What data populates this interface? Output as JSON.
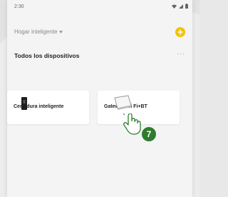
{
  "status_bar": {
    "time": "2:30",
    "icons": [
      "wifi-icon",
      "signal-icon",
      "battery-icon"
    ]
  },
  "header": {
    "home_name": "Hogar inteligente",
    "add_icon": "plus-icon",
    "accent_color": "#f3c200"
  },
  "section": {
    "title": "Todos los dispositivos",
    "more_label": "···"
  },
  "devices": [
    {
      "label": "Cerradura inteligente",
      "icon": "smart-lock-icon"
    },
    {
      "label": "Gateway Wi Fi+BT",
      "icon": "gateway-icon"
    }
  ],
  "annotation": {
    "step": "7",
    "badge_color": "#2e7d2e",
    "pointer": "tap-hand-icon"
  }
}
